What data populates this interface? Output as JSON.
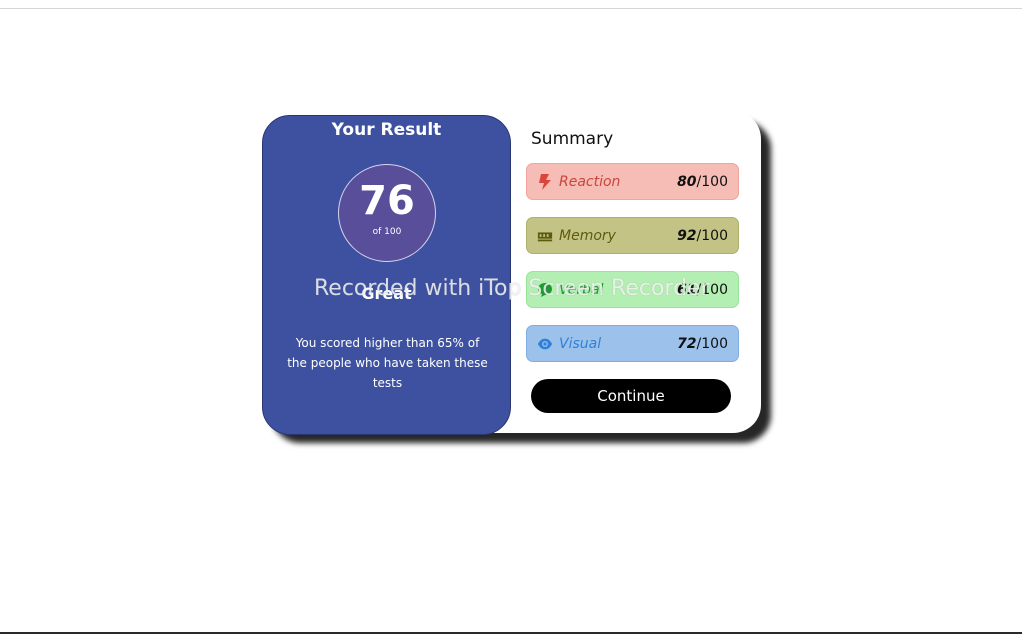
{
  "result": {
    "title": "Your Result",
    "score": "76",
    "score_of": "of 100",
    "rating": "Great",
    "percentile_text": "You scored higher than 65% of the people who have taken these tests"
  },
  "summary": {
    "title": "Summary",
    "items": [
      {
        "label": "Reaction",
        "score": "80",
        "max": "/100",
        "icon": "lightning-icon",
        "color": "#c8463a"
      },
      {
        "label": "Memory",
        "score": "92",
        "max": "/100",
        "icon": "memory-chip-icon",
        "color": "#5e5b0d"
      },
      {
        "label": "Verbal",
        "score": "61",
        "max": "/100",
        "icon": "chat-icon",
        "color": "#1f9a33"
      },
      {
        "label": "Visual",
        "score": "72",
        "max": "/100",
        "icon": "eye-icon",
        "color": "#2f80d8"
      }
    ],
    "continue_label": "Continue"
  },
  "watermark": "Recorded with iTop Screen Recorder"
}
